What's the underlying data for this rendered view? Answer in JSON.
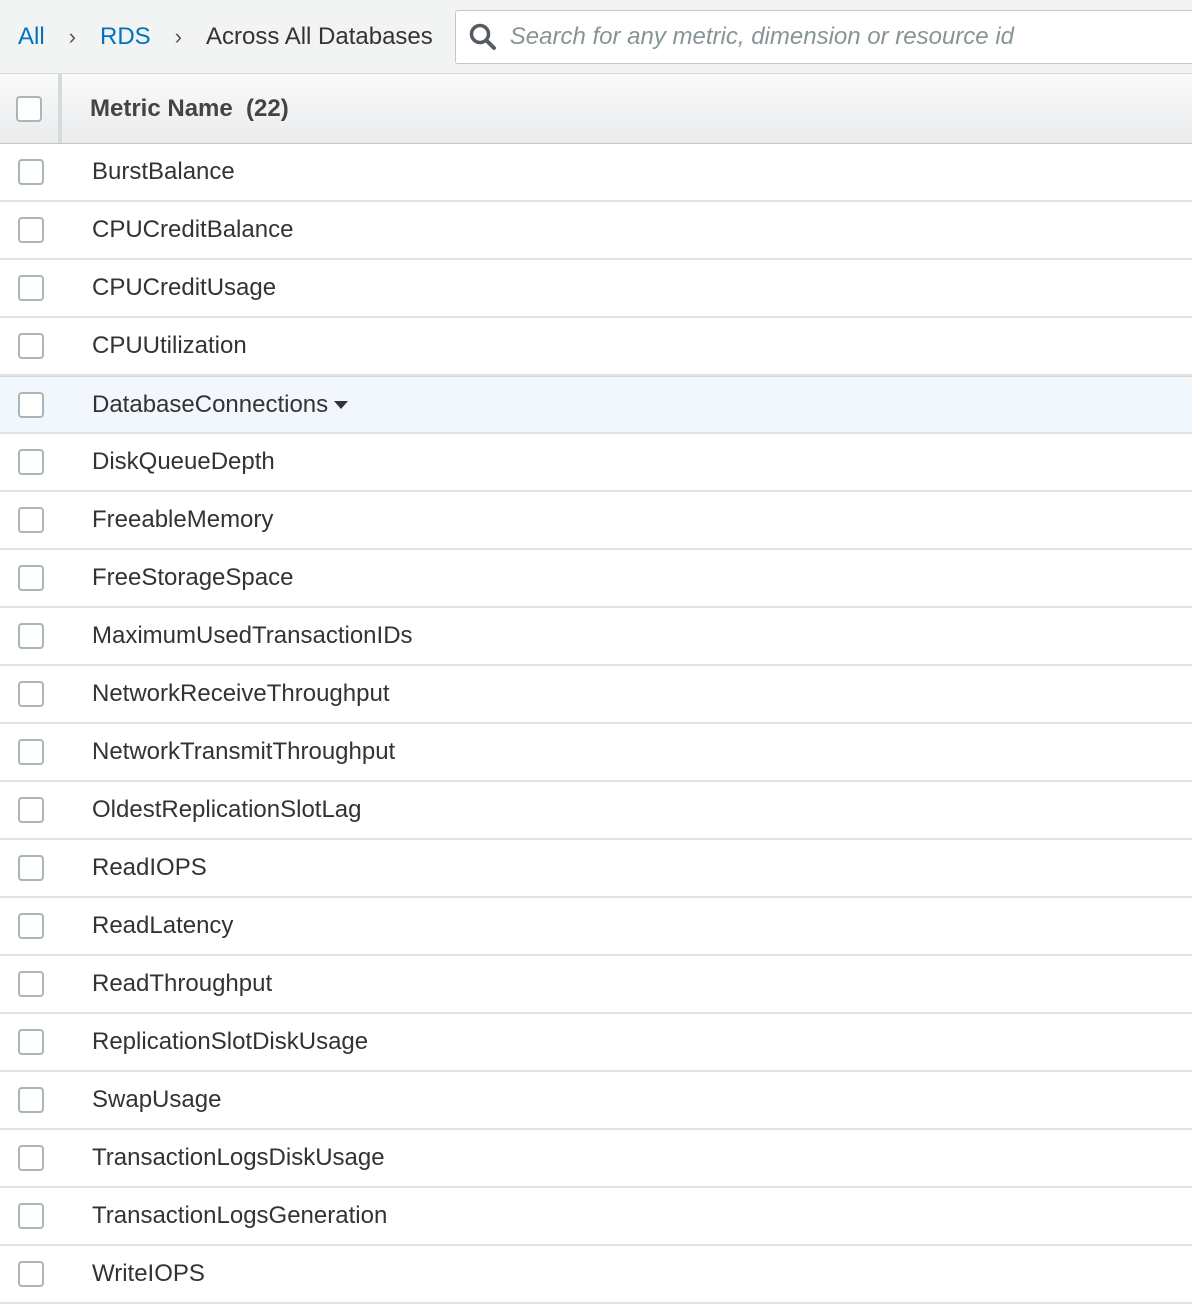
{
  "breadcrumb": {
    "items": [
      "All",
      "RDS",
      "Across All Databases"
    ]
  },
  "search": {
    "placeholder": "Search for any metric, dimension or resource id"
  },
  "table": {
    "header_label": "Metric Name  (22)",
    "rows": [
      "BurstBalance",
      "CPUCreditBalance",
      "CPUCreditUsage",
      "CPUUtilization",
      "DatabaseConnections",
      "DiskQueueDepth",
      "FreeableMemory",
      "FreeStorageSpace",
      "MaximumUsedTransactionIDs",
      "NetworkReceiveThroughput",
      "NetworkTransmitThroughput",
      "OldestReplicationSlotLag",
      "ReadIOPS",
      "ReadLatency",
      "ReadThroughput",
      "ReplicationSlotDiskUsage",
      "SwapUsage",
      "TransactionLogsDiskUsage",
      "TransactionLogsGeneration",
      "WriteIOPS"
    ],
    "highlighted_row_index": 4
  },
  "colors": {
    "link": "#0073bb",
    "highlight_row": "#f1f7fd",
    "header_bg": "#f2f3f3"
  }
}
